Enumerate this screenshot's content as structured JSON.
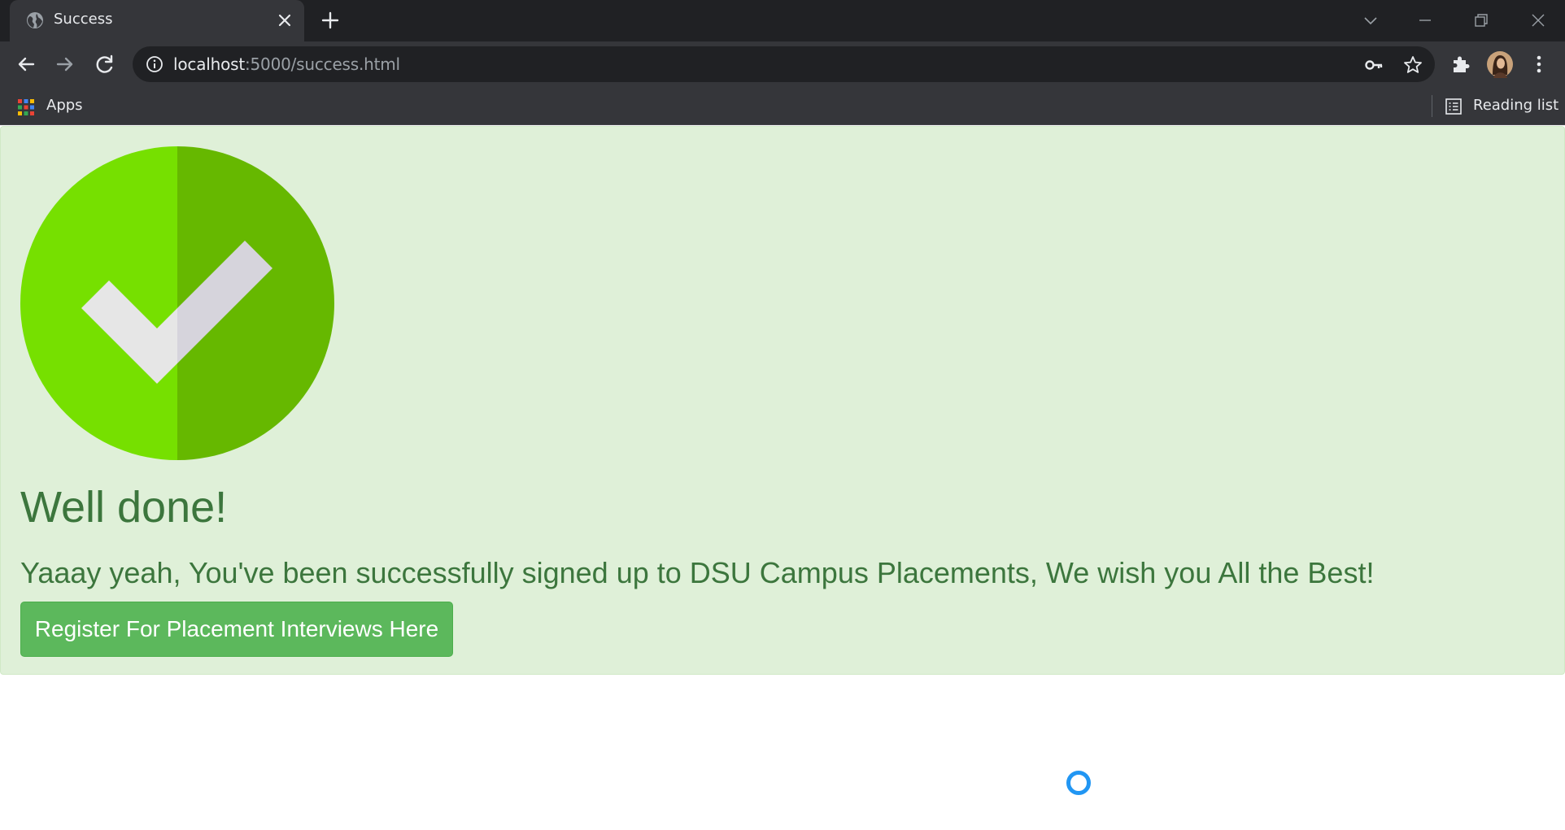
{
  "browser": {
    "tab": {
      "title": "Success"
    },
    "url": {
      "host": "localhost",
      "rest": ":5000/success.html"
    },
    "bookmarks": {
      "apps_label": "Apps",
      "reading_list_label": "Reading list"
    }
  },
  "page": {
    "heading": "Well done!",
    "message": "Yaaay yeah, You've been successfully signed up to DSU Campus Placements, We wish you All the Best!",
    "register_button": "Register For Placement Interviews Here"
  },
  "colors": {
    "alert_bg": "#dff0d8",
    "alert_text": "#3c763d",
    "button_bg": "#5cb85c",
    "check_left": "#76e000",
    "check_right": "#66b800",
    "spinner": "#2196f3"
  },
  "icons": [
    "globe-icon",
    "close-icon",
    "plus-icon",
    "back-icon",
    "forward-icon",
    "reload-icon",
    "info-icon",
    "key-icon",
    "star-icon",
    "puzzle-icon",
    "avatar",
    "more-icon",
    "apps-grid-icon",
    "reading-list-icon",
    "check-circle-icon",
    "loading-spinner"
  ]
}
